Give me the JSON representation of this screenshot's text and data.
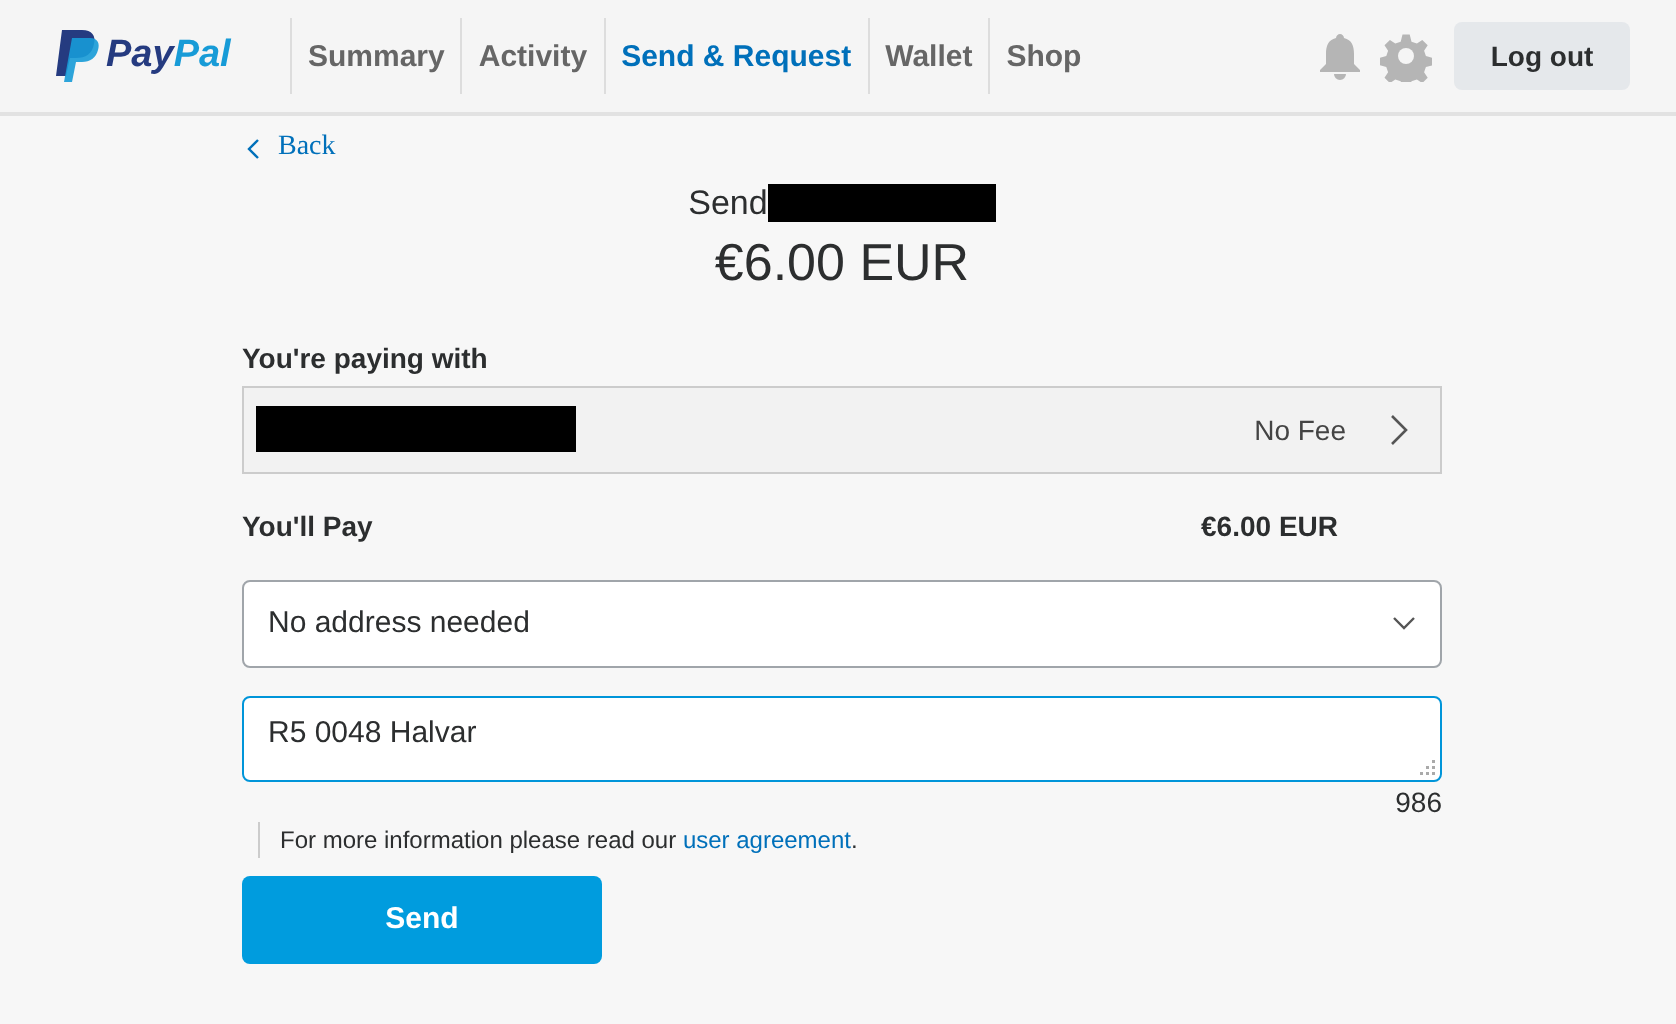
{
  "header": {
    "logo": "PayPal",
    "nav": [
      {
        "label": "Summary",
        "selected": false
      },
      {
        "label": "Activity",
        "selected": false
      },
      {
        "label": "Send & Request",
        "selected": true
      },
      {
        "label": "Wallet",
        "selected": false
      },
      {
        "label": "Shop",
        "selected": false
      }
    ],
    "logout": "Log out"
  },
  "back": "Back",
  "title": "Send",
  "amount": "€6.00 EUR",
  "paying_with": {
    "label": "You're paying with",
    "fee": "No Fee"
  },
  "total": {
    "label": "You'll Pay",
    "value": "€6.00 EUR"
  },
  "address": {
    "value": "No address needed"
  },
  "note": {
    "value": "R5 0048 Halvar",
    "counter": "986"
  },
  "info": {
    "text": "For more information please read our ",
    "link": "user agreement",
    "after": "."
  },
  "send_button": "Send"
}
